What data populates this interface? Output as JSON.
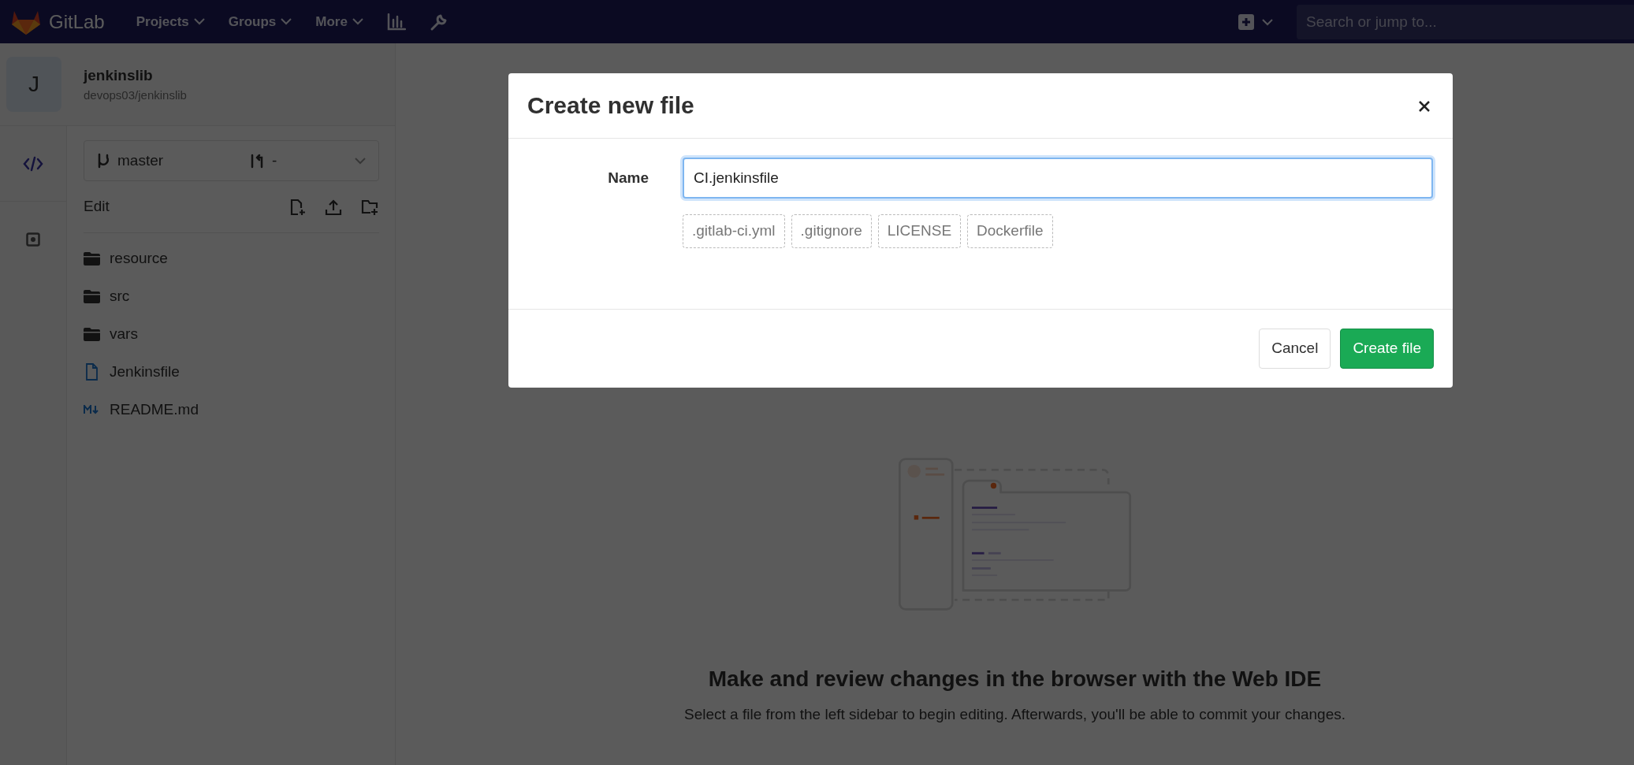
{
  "navbar": {
    "brand": "GitLab",
    "menus": [
      "Projects",
      "Groups",
      "More"
    ],
    "search": {
      "placeholder": "Search or jump to..."
    }
  },
  "project": {
    "avatar_letter": "J",
    "name": "jenkinslib",
    "path": "devops03/jenkinslib"
  },
  "activity_bar": [
    {
      "kind": "edit",
      "selected": true
    },
    {
      "kind": "commit",
      "selected": false
    }
  ],
  "branch": {
    "name": "master",
    "merge_request": "-"
  },
  "tree": {
    "title": "Edit",
    "files": [
      {
        "name": "resource",
        "kind": "folder"
      },
      {
        "name": "src",
        "kind": "folder"
      },
      {
        "name": "vars",
        "kind": "folder"
      },
      {
        "name": "Jenkinsfile",
        "kind": "file"
      },
      {
        "name": "README.md",
        "kind": "markdown"
      }
    ]
  },
  "empty_state": {
    "title": "Make and review changes in the browser with the Web IDE",
    "description": "Select a file from the left sidebar to begin editing. Afterwards, you'll be able to commit your changes."
  },
  "dialog": {
    "title": "Create new file",
    "name_label": "Name",
    "name_value": "CI.jenkinsfile",
    "templates": [
      ".gitlab-ci.yml",
      ".gitignore",
      "LICENSE",
      "Dockerfile"
    ],
    "buttons": [
      {
        "label": "Cancel",
        "kind": "secondary"
      },
      {
        "label": "Create file",
        "kind": "primary"
      }
    ]
  }
}
